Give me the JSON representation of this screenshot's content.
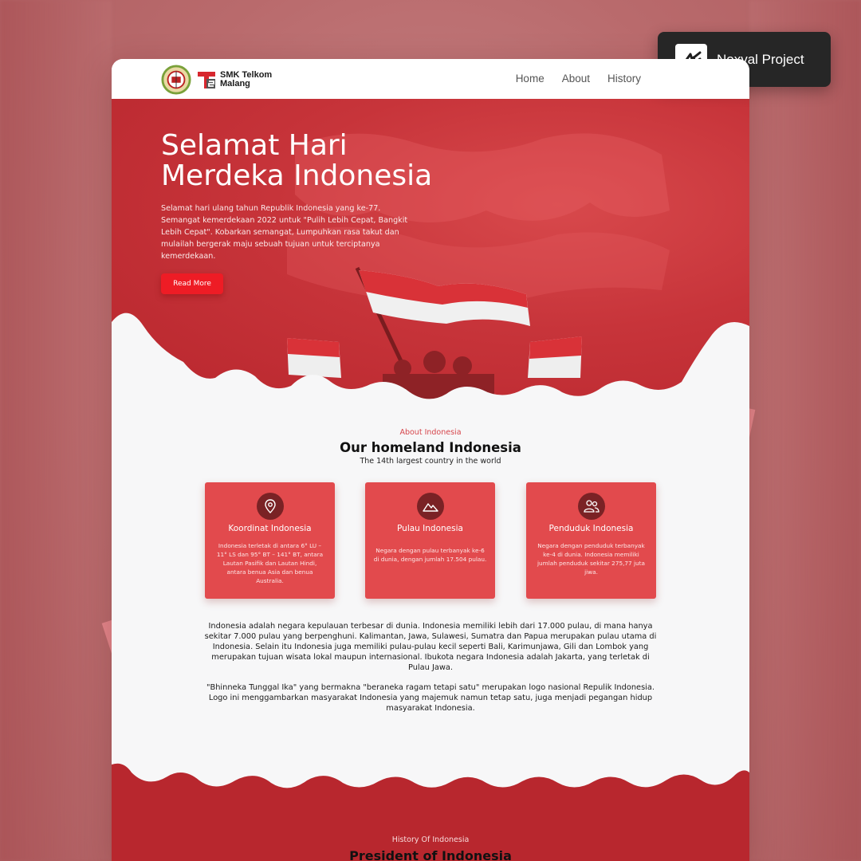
{
  "badge": {
    "label": "Noxval Project",
    "icon": "noxval-logo-icon"
  },
  "navbar": {
    "brand": [
      "SMK Telkom",
      "Malang"
    ],
    "links": [
      "Home",
      "About",
      "History"
    ]
  },
  "hero": {
    "title_lines": [
      "Selamat Hari",
      "Merdeka Indonesia"
    ],
    "text": "Selamat hari ulang tahun Republik Indonesia yang ke-77. Semangat kemerdekaan 2022 untuk \"Pulih Lebih Cepat, Bangkit Lebih Cepat\". Kobarkan semangat, Lumpuhkan rasa takut dan mulailah bergerak maju sebuah tujuan untuk terciptanya kemerdekaan.",
    "button": "Read More"
  },
  "about": {
    "eyebrow": "About Indonesia",
    "title": "Our homeland Indonesia",
    "subtitle": "The 14th largest country in the world",
    "cards": [
      {
        "icon": "location-pin-icon",
        "title": "Koordinat Indonesia",
        "text": "Indonesia terletak di antara 6° LU – 11° LS dan 95° BT – 141° BT, antara Lautan Pasifik dan Lautan Hindi, antara benua Asia dan benua Australia."
      },
      {
        "icon": "mountain-icon",
        "title": "Pulau Indonesia",
        "text": "Negara dengan pulau terbanyak ke-6 di dunia, dengan jumlah 17.504 pulau."
      },
      {
        "icon": "people-icon",
        "title": "Penduduk Indonesia",
        "text": "Negara dengan penduduk terbanyak ke-4 di dunia. Indonesia memiliki jumlah penduduk sekitar 275,77 juta jiwa."
      }
    ],
    "paragraph1": "Indonesia adalah negara kepulauan terbesar di dunia. Indonesia memiliki lebih dari 17.000 pulau, di mana hanya sekitar 7.000 pulau yang berpenghuni. Kalimantan, Jawa, Sulawesi, Sumatra dan Papua merupakan pulau utama di Indonesia. Selain itu Indonesia juga memiliki pulau-pulau kecil seperti Bali, Karimunjawa, Gili dan Lombok yang merupakan tujuan wisata lokal maupun internasional. Ibukota negara Indonesia adalah Jakarta, yang terletak di Pulau Jawa.",
    "paragraph2": "\"Bhinneka Tunggal Ika\" yang bermakna \"beraneka ragam tetapi satu\" merupakan logo nasional Repulik Indonesia. Logo ini menggambarkan masyarakat Indonesia yang majemuk namun tetap satu, juga menjadi pegangan hidup masyarakat Indonesia."
  },
  "history": {
    "eyebrow": "History Of Indonesia",
    "title": "President of Indonesia"
  },
  "colors": {
    "primary_red": "#c7343a",
    "card_red": "#e24a4d",
    "button_red": "#ee1c25",
    "page_bg": "#f7f7f8",
    "badge_bg": "#262626"
  }
}
